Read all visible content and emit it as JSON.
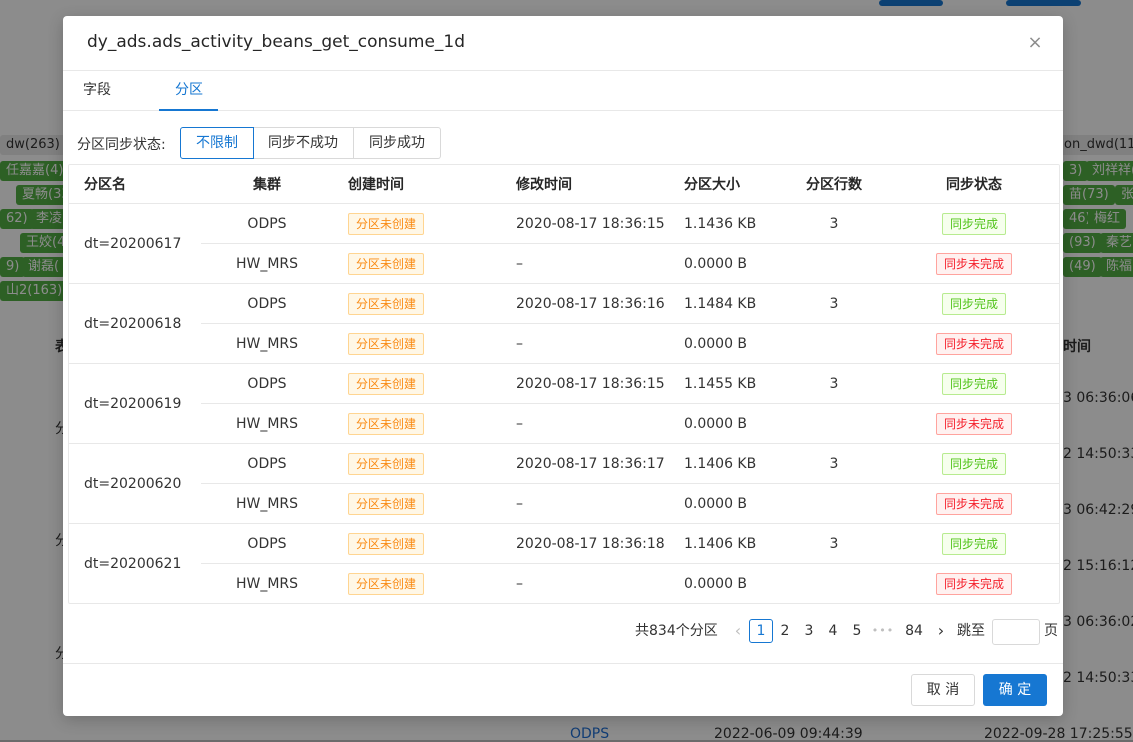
{
  "background": {
    "tags_left": [
      "dw(263)",
      "任嘉嘉(4)",
      "夏畅(33)",
      "62)",
      "李凌",
      "王姣(4",
      "9)",
      "谢磊(",
      "山2(163)"
    ],
    "tags_right": [
      "on_dwd(11)",
      "3)",
      "刘祥祥(",
      "苗(73)",
      "张",
      "46)",
      "梅红",
      "(93)",
      "秦艺",
      "(49)",
      "陈福"
    ],
    "col_fragment_left": "表",
    "col_fragment_right": "时间",
    "rows_left": [
      "分",
      "分",
      "分",
      "分",
      "分"
    ],
    "rows_right": [
      "3 06:36:06",
      "2 14:50:33",
      "3 06:42:29",
      "2 15:16:12",
      "3 06:36:02",
      "2 14:50:33"
    ],
    "bottom_row": {
      "cluster": "ODPS",
      "created": "2022-06-09 09:44:39",
      "modified": "2022-09-28 17:25:55"
    }
  },
  "modal": {
    "title": "dy_ads.ads_activity_beans_get_consume_1d",
    "close_icon": "×",
    "tabs": [
      {
        "label": "字段",
        "active": false
      },
      {
        "label": "分区",
        "active": true
      }
    ],
    "filter": {
      "label": "分区同步状态:",
      "options": [
        "不限制",
        "同步不成功",
        "同步成功"
      ],
      "selected": "不限制"
    },
    "table": {
      "columns": [
        "分区名",
        "集群",
        "创建时间",
        "修改时间",
        "分区大小",
        "分区行数",
        "同步状态"
      ],
      "groups": [
        {
          "partition": "dt=20200617",
          "rows": [
            {
              "cluster": "ODPS",
              "created": "分区未创建",
              "modified": "2020-08-17 18:36:15",
              "size": "1.1436 KB",
              "rows": "3",
              "status": "同步完成",
              "ok": true
            },
            {
              "cluster": "HW_MRS",
              "created": "分区未创建",
              "modified": "–",
              "size": "0.0000 B",
              "rows": "",
              "status": "同步未完成",
              "ok": false
            }
          ]
        },
        {
          "partition": "dt=20200618",
          "rows": [
            {
              "cluster": "ODPS",
              "created": "分区未创建",
              "modified": "2020-08-17 18:36:16",
              "size": "1.1484 KB",
              "rows": "3",
              "status": "同步完成",
              "ok": true
            },
            {
              "cluster": "HW_MRS",
              "created": "分区未创建",
              "modified": "–",
              "size": "0.0000 B",
              "rows": "",
              "status": "同步未完成",
              "ok": false
            }
          ]
        },
        {
          "partition": "dt=20200619",
          "rows": [
            {
              "cluster": "ODPS",
              "created": "分区未创建",
              "modified": "2020-08-17 18:36:15",
              "size": "1.1455 KB",
              "rows": "3",
              "status": "同步完成",
              "ok": true
            },
            {
              "cluster": "HW_MRS",
              "created": "分区未创建",
              "modified": "–",
              "size": "0.0000 B",
              "rows": "",
              "status": "同步未完成",
              "ok": false
            }
          ]
        },
        {
          "partition": "dt=20200620",
          "rows": [
            {
              "cluster": "ODPS",
              "created": "分区未创建",
              "modified": "2020-08-17 18:36:17",
              "size": "1.1406 KB",
              "rows": "3",
              "status": "同步完成",
              "ok": true
            },
            {
              "cluster": "HW_MRS",
              "created": "分区未创建",
              "modified": "–",
              "size": "0.0000 B",
              "rows": "",
              "status": "同步未完成",
              "ok": false
            }
          ]
        },
        {
          "partition": "dt=20200621",
          "rows": [
            {
              "cluster": "ODPS",
              "created": "分区未创建",
              "modified": "2020-08-17 18:36:18",
              "size": "1.1406 KB",
              "rows": "3",
              "status": "同步完成",
              "ok": true
            },
            {
              "cluster": "HW_MRS",
              "created": "分区未创建",
              "modified": "–",
              "size": "0.0000 B",
              "rows": "",
              "status": "同步未完成",
              "ok": false
            }
          ]
        }
      ]
    },
    "pagination": {
      "total": "共834个分区",
      "prev_icon": "‹",
      "pages": [
        "1",
        "2",
        "3",
        "4",
        "5"
      ],
      "current": "1",
      "ellipsis": "•••",
      "last": "84",
      "next_icon": "›",
      "jump_label": "跳至",
      "jump_value": "",
      "page_suffix": "页"
    },
    "footer": {
      "cancel_label": "取 消",
      "ok_label": "确 定"
    },
    "colors": {
      "primary": "#1677d2",
      "warn": "#fa8c16",
      "success": "#52c41a",
      "error": "#f5222d"
    }
  }
}
